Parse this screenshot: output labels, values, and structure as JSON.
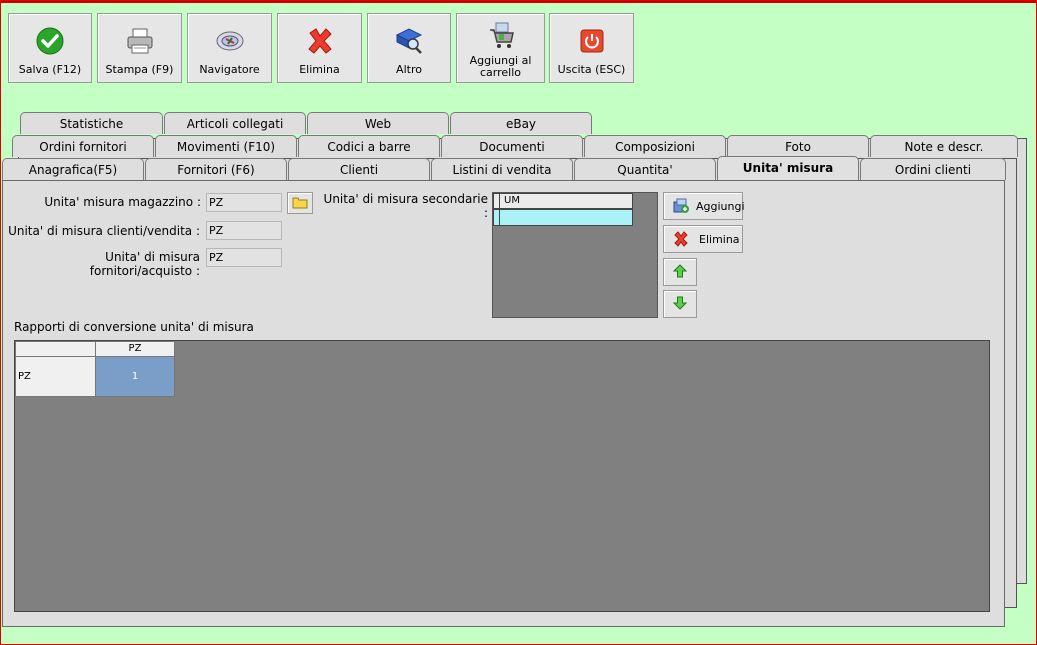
{
  "toolbar": {
    "buttons": [
      {
        "label": "Salva (F12)"
      },
      {
        "label": "Stampa (F9)"
      },
      {
        "label": "Navigatore"
      },
      {
        "label": "Elimina"
      },
      {
        "label": "Altro"
      },
      {
        "label": "Aggiungi al carrello"
      },
      {
        "label": "Uscita (ESC)"
      }
    ]
  },
  "tabs": {
    "row1": [
      "Statistiche",
      "Articoli collegati",
      "Web",
      "eBay"
    ],
    "row2": [
      "Ordini fornitori",
      "Movimenti (F10)",
      "Codici a barre",
      "Documenti",
      "Composizioni",
      "Foto",
      "Note e descr."
    ],
    "row3": [
      "Anagrafica(F5)",
      "Fornitori (F6)",
      "Clienti",
      "Listini di vendita",
      "Quantita'",
      "Unita' misura",
      "Ordini clienti"
    ],
    "active": "Unita' misura"
  },
  "form": {
    "um_magazzino_label": "Unita' misura magazzino :",
    "um_magazzino_value": "PZ",
    "um_clienti_label": "Unita' di misura clienti/vendita :",
    "um_clienti_value": "PZ",
    "um_fornitori_label": "Unita' di misura fornitori/acquisto :",
    "um_fornitori_value": "PZ",
    "secondarie_label": "Unita' di misura secondarie :",
    "secondarie_header": "UM",
    "aggiungi_label": "Aggiungi",
    "elimina_label": "Elimina"
  },
  "conversion": {
    "title": "Rapporti di conversione unita' di misura",
    "col_header": "PZ",
    "row_header": "PZ",
    "value": "1"
  },
  "colors": {
    "background": "#c4ffc4",
    "accent_red": "#e00000",
    "selected_cell": "#7b9ec8",
    "secondary_row": "#aaf2f5"
  }
}
